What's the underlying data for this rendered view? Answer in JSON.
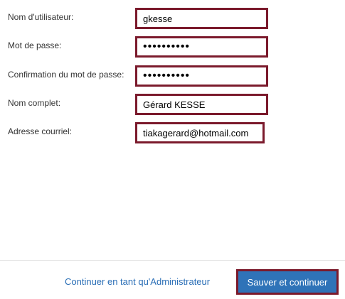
{
  "form": {
    "fields": [
      {
        "label": "Nom d'utilisateur:",
        "value": "gkesse",
        "type": "text"
      },
      {
        "label": "Mot de passe:",
        "value": "••••••••••",
        "type": "password"
      },
      {
        "label": "Confirmation du mot de passe:",
        "value": "••••••••••",
        "type": "password"
      },
      {
        "label": "Nom complet:",
        "value": "Gérard KESSE",
        "type": "text"
      },
      {
        "label": "Adresse courriel:",
        "value": "tiakagerard@hotmail.com",
        "type": "text"
      }
    ]
  },
  "footer": {
    "admin_link_label": "Continuer en tant qu'Administrateur",
    "save_label": "Sauver et continuer"
  },
  "colors": {
    "field_border": "#7b1a2c",
    "button_background": "#2f73b8",
    "link": "#2a6eb6"
  }
}
